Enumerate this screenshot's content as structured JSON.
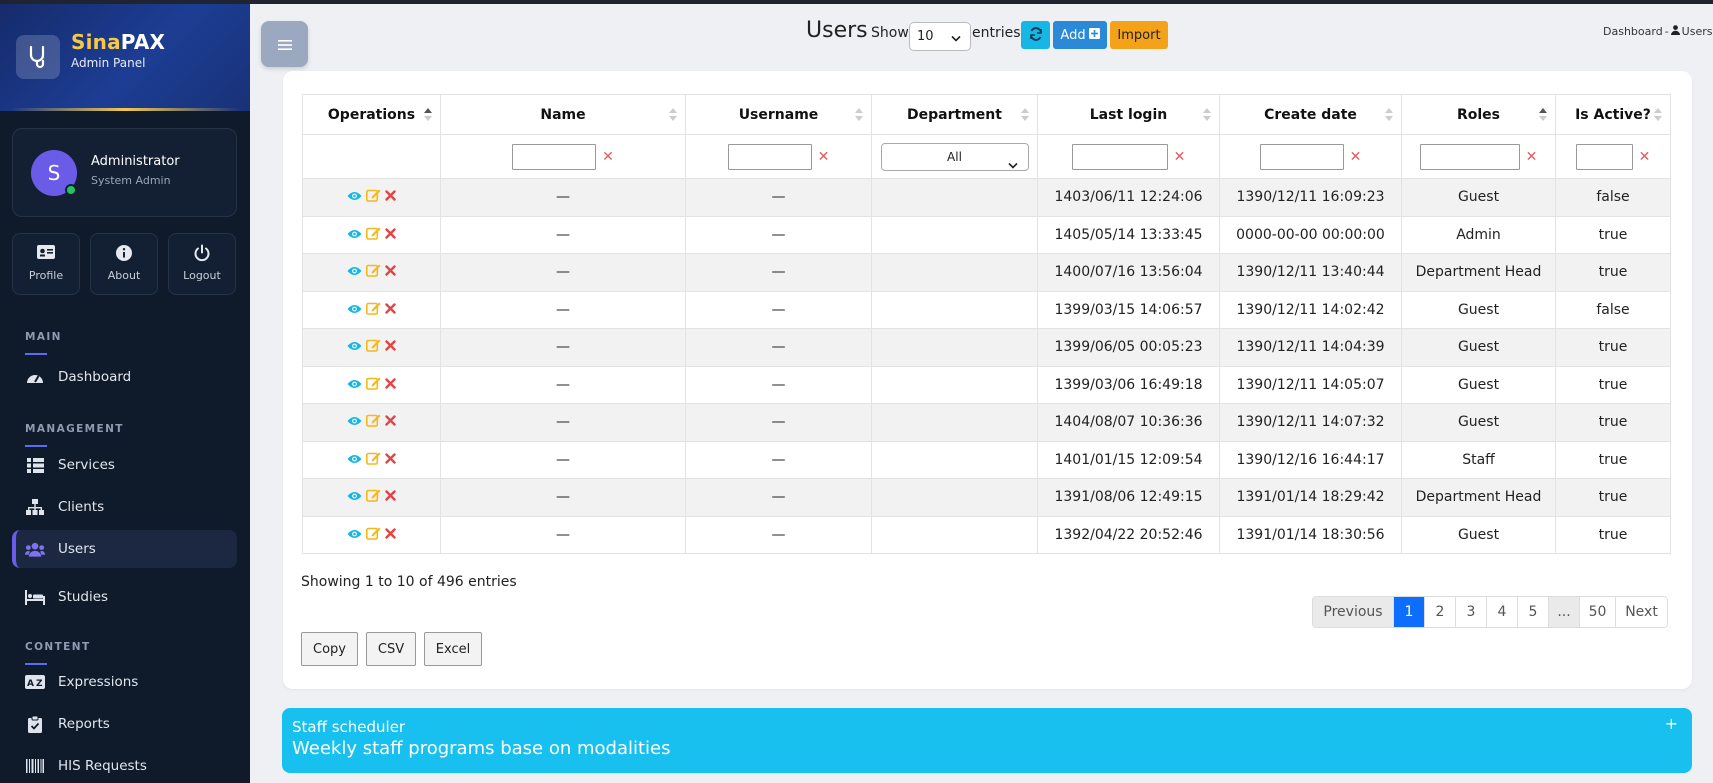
{
  "brand": {
    "name_part1": "Sina",
    "name_part2": "PAX",
    "subtitle": "Admin Panel"
  },
  "user": {
    "initial": "S",
    "name": "Administrator",
    "role": "System Admin"
  },
  "quick_actions": [
    {
      "label": "Profile",
      "icon": "id-card-icon"
    },
    {
      "label": "About",
      "icon": "info-icon"
    },
    {
      "label": "Logout",
      "icon": "power-icon"
    }
  ],
  "sidebar": {
    "sections": {
      "main": "MAIN",
      "management": "MANAGEMENT",
      "content": "CONTENT"
    },
    "items": [
      {
        "label": "Dashboard",
        "icon": "gauge-icon",
        "active": false
      },
      {
        "label": "Services",
        "icon": "grid-list-icon",
        "active": false
      },
      {
        "label": "Clients",
        "icon": "network-icon",
        "active": false
      },
      {
        "label": "Users",
        "icon": "users-icon",
        "active": true
      },
      {
        "label": "Studies",
        "icon": "bed-icon",
        "active": false
      },
      {
        "label": "Expressions",
        "icon": "spell-check-icon",
        "active": false
      },
      {
        "label": "Reports",
        "icon": "clipboard-icon",
        "active": false
      },
      {
        "label": "HIS Requests",
        "icon": "barcode-icon",
        "active": false
      }
    ]
  },
  "header": {
    "title": "Users",
    "show_label": "Show",
    "page_length": "10",
    "entries_label": "entries",
    "add_label": "Add",
    "import_label": "Import",
    "breadcrumb": {
      "home": "Dashboard",
      "separator": "-",
      "current": "Users"
    }
  },
  "table": {
    "columns": [
      "Operations",
      "Name",
      "Username",
      "Department",
      "Last login",
      "Create date",
      "Roles",
      "Is Active?"
    ],
    "department_filter": "All",
    "rows": [
      {
        "name": "—",
        "username": "—",
        "department": "",
        "last_login": "1403/06/11 12:24:06",
        "create_date": "1390/12/11 16:09:23",
        "role": "Guest",
        "active": "false"
      },
      {
        "name": "—",
        "username": "—",
        "department": "",
        "last_login": "1405/05/14 13:33:45",
        "create_date": "0000-00-00 00:00:00",
        "role": "Admin",
        "active": "true"
      },
      {
        "name": "—",
        "username": "—",
        "department": "",
        "last_login": "1400/07/16 13:56:04",
        "create_date": "1390/12/11 13:40:44",
        "role": "Department Head",
        "active": "true"
      },
      {
        "name": "—",
        "username": "—",
        "department": "",
        "last_login": "1399/03/15 14:06:57",
        "create_date": "1390/12/11 14:02:42",
        "role": "Guest",
        "active": "false"
      },
      {
        "name": "—",
        "username": "—",
        "department": "",
        "last_login": "1399/06/05 00:05:23",
        "create_date": "1390/12/11 14:04:39",
        "role": "Guest",
        "active": "true"
      },
      {
        "name": "—",
        "username": "—",
        "department": "",
        "last_login": "1399/03/06 16:49:18",
        "create_date": "1390/12/11 14:05:07",
        "role": "Guest",
        "active": "true"
      },
      {
        "name": "—",
        "username": "—",
        "department": "",
        "last_login": "1404/08/07 10:36:36",
        "create_date": "1390/12/11 14:07:32",
        "role": "Guest",
        "active": "true"
      },
      {
        "name": "—",
        "username": "—",
        "department": "",
        "last_login": "1401/01/15 12:09:54",
        "create_date": "1390/12/16 16:44:17",
        "role": "Staff",
        "active": "true"
      },
      {
        "name": "—",
        "username": "—",
        "department": "",
        "last_login": "1391/08/06 12:49:15",
        "create_date": "1391/01/14 18:29:42",
        "role": "Department Head",
        "active": "true"
      },
      {
        "name": "—",
        "username": "—",
        "department": "",
        "last_login": "1392/04/22 20:52:46",
        "create_date": "1391/01/14 18:30:56",
        "role": "Guest",
        "active": "true"
      }
    ]
  },
  "info": "Showing 1 to 10 of 496 entries",
  "pagination": {
    "previous": "Previous",
    "pages": [
      "1",
      "2",
      "3",
      "4",
      "5"
    ],
    "ellipsis": "...",
    "last": "50",
    "next": "Next"
  },
  "export": {
    "copy": "Copy",
    "csv": "CSV",
    "excel": "Excel"
  },
  "banner": {
    "title": "Staff scheduler",
    "subtitle": "Weekly staff programs base on modalities",
    "toggle": "+"
  },
  "colors": {
    "sidebar_bg": "#0f1a2b",
    "accent": "#6b5ce7",
    "view": "#17b7e5",
    "edit": "#f5b81b",
    "delete": "#e04646",
    "banner": "#17c0ef",
    "page_active": "#0d6efd"
  }
}
